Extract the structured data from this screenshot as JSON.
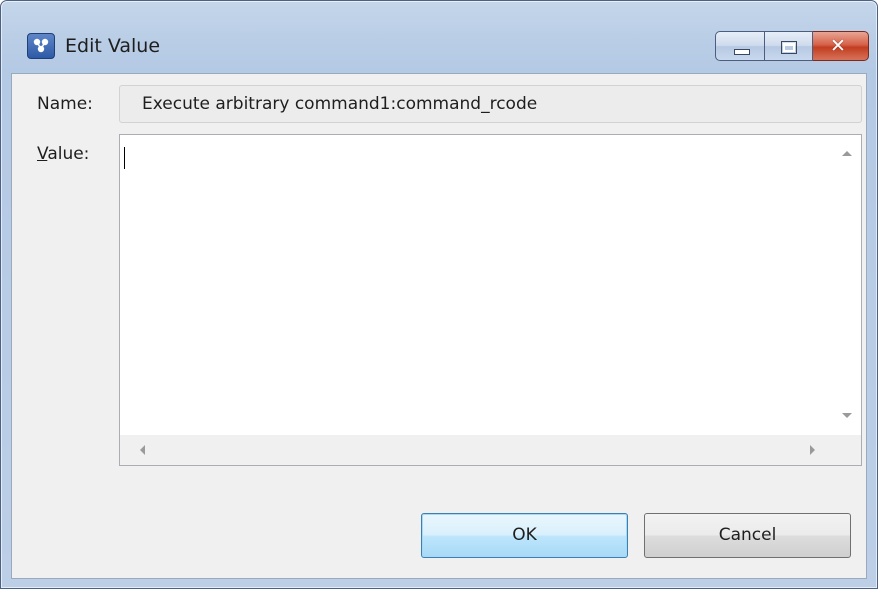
{
  "window": {
    "title": "Edit Value",
    "icon": "app-icon",
    "controls": {
      "minimize_icon": "minimize-icon",
      "maximize_icon": "maximize-icon",
      "close_icon": "close-icon",
      "close_glyph": "✕"
    }
  },
  "form": {
    "name_label": "Name:",
    "name_value": "Execute arbitrary command1:command_rcode",
    "value_label_mnemonic": "V",
    "value_label_rest": "alue:",
    "value_text": ""
  },
  "buttons": {
    "ok_label": "OK",
    "cancel_label": "Cancel"
  },
  "colors": {
    "title_bar": "#b9cde6",
    "close_button": "#c23d20",
    "default_button_border": "#3c7fb1",
    "client_background": "#f0f0f0"
  }
}
